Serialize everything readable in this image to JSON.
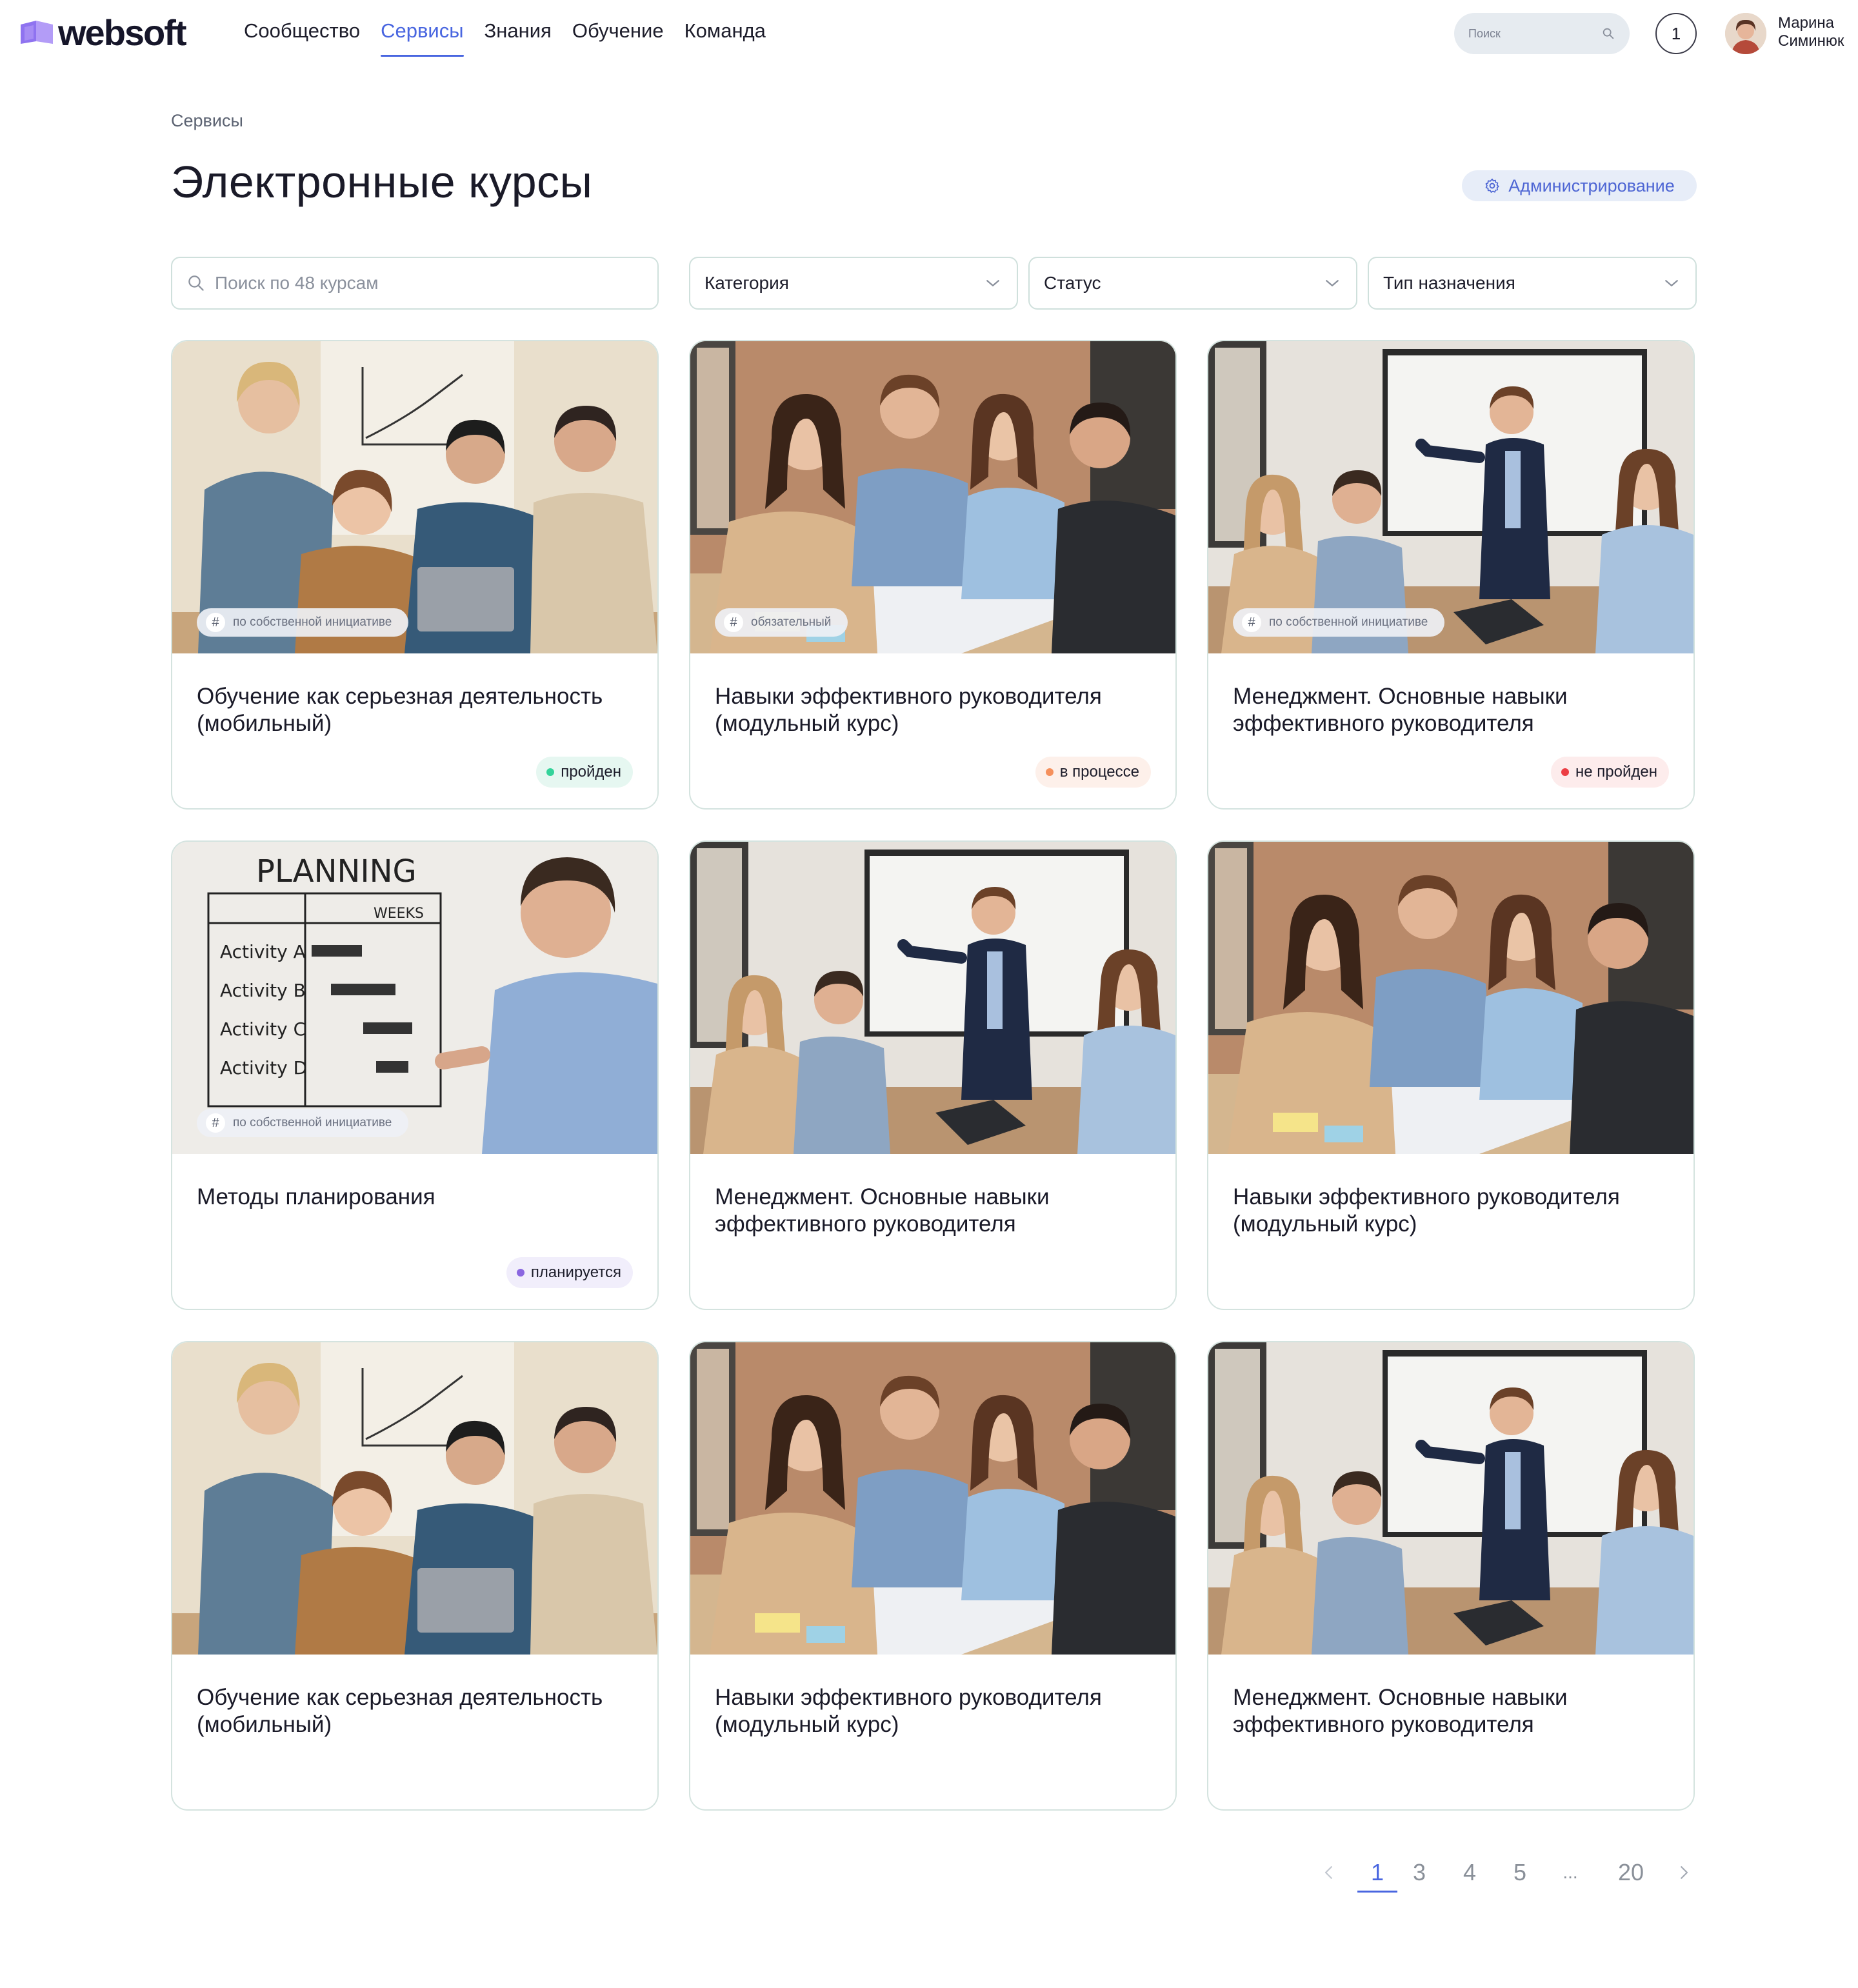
{
  "header": {
    "brand": "websoft",
    "nav": [
      {
        "label": "Сообщество",
        "active": false
      },
      {
        "label": "Сервисы",
        "active": true
      },
      {
        "label": "Знания",
        "active": false
      },
      {
        "label": "Обучение",
        "active": false
      },
      {
        "label": "Команда",
        "active": false
      }
    ],
    "search_placeholder": "Поиск",
    "notifications_count": "1",
    "user": {
      "first_name": "Марина",
      "last_name": "Симинюк"
    }
  },
  "breadcrumb": "Сервисы",
  "page_title": "Электронные курсы",
  "admin_button": "Администрирование",
  "filters": {
    "search_placeholder": "Поиск по 48 курсам",
    "category": "Категория",
    "status": "Статус",
    "assignment_type": "Тип назначения"
  },
  "courses": [
    {
      "title": "Обучение как серьезная деятельность (мобильный)",
      "tag": "по собственной инициативе",
      "status": "пройден",
      "image": "team-chart"
    },
    {
      "title": "Навыки эффективного руководителя (модульный курс)",
      "tag": "обязательный",
      "status": "в процессе",
      "image": "team-table"
    },
    {
      "title": "Менеджмент. Основные навыки эффективного руководителя",
      "tag": "по собственной инициативе",
      "status": "не пройден",
      "image": "presentation"
    },
    {
      "title": "Методы планирования",
      "tag": "по собственной инициативе",
      "status": "планируется",
      "image": "planning",
      "image_text": {
        "heading": "PLANNING",
        "column": "WEEKS",
        "rows": [
          "Activity A",
          "Activity B",
          "Activity C",
          "Activity D"
        ]
      }
    },
    {
      "title": "Менеджмент. Основные навыки эффективного руководителя",
      "tag": "",
      "status": "",
      "image": "presentation"
    },
    {
      "title": "Навыки эффективного руководителя (модульный курс)",
      "tag": "",
      "status": "",
      "image": "team-table"
    },
    {
      "title": "Обучение как серьезная деятельность (мобильный)",
      "tag": "",
      "status": "",
      "image": "team-chart"
    },
    {
      "title": "Навыки эффективного руководителя (модульный курс)",
      "tag": "",
      "status": "",
      "image": "team-table"
    },
    {
      "title": "Менеджмент. Основные навыки эффективного руководителя",
      "tag": "",
      "status": "",
      "image": "presentation"
    }
  ],
  "pagination": {
    "pages": [
      "1",
      "3",
      "4",
      "5",
      "...",
      "20"
    ],
    "current": "1"
  },
  "colors": {
    "accent": "#4966e0",
    "done": "#34d39a",
    "in_progress": "#f5905c",
    "failed": "#ec3e44",
    "planned": "#8a66e0"
  }
}
